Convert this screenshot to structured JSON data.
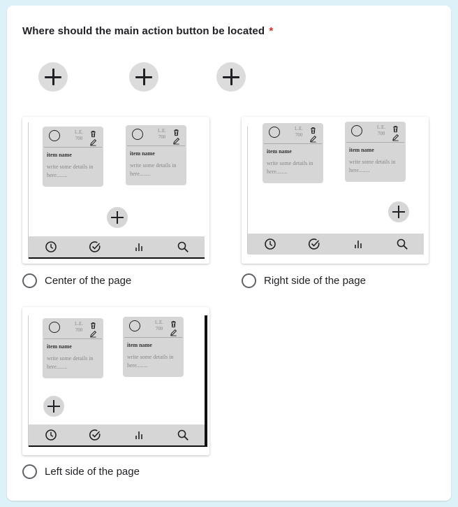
{
  "question": {
    "text": "Where should the main action button be located",
    "required_mark": "*"
  },
  "colors": {
    "required": "#d93025",
    "page_bg": "#ddf2f8",
    "mock_gray": "#d6d6d6"
  },
  "note": {
    "le_line1": "L.E.",
    "le_line2": "700",
    "item_name": "item name",
    "details": "write some details in here........"
  },
  "options": [
    {
      "label": "Center of the page"
    },
    {
      "label": "Right side of the page"
    },
    {
      "label": "Left side of the page"
    }
  ],
  "icons": {
    "fab": "plus-icon",
    "nav": [
      "clock-icon",
      "check-circle-icon",
      "bar-chart-icon",
      "search-icon"
    ],
    "note": [
      "radio-circle-icon",
      "trash-icon",
      "pencil-icon"
    ]
  }
}
